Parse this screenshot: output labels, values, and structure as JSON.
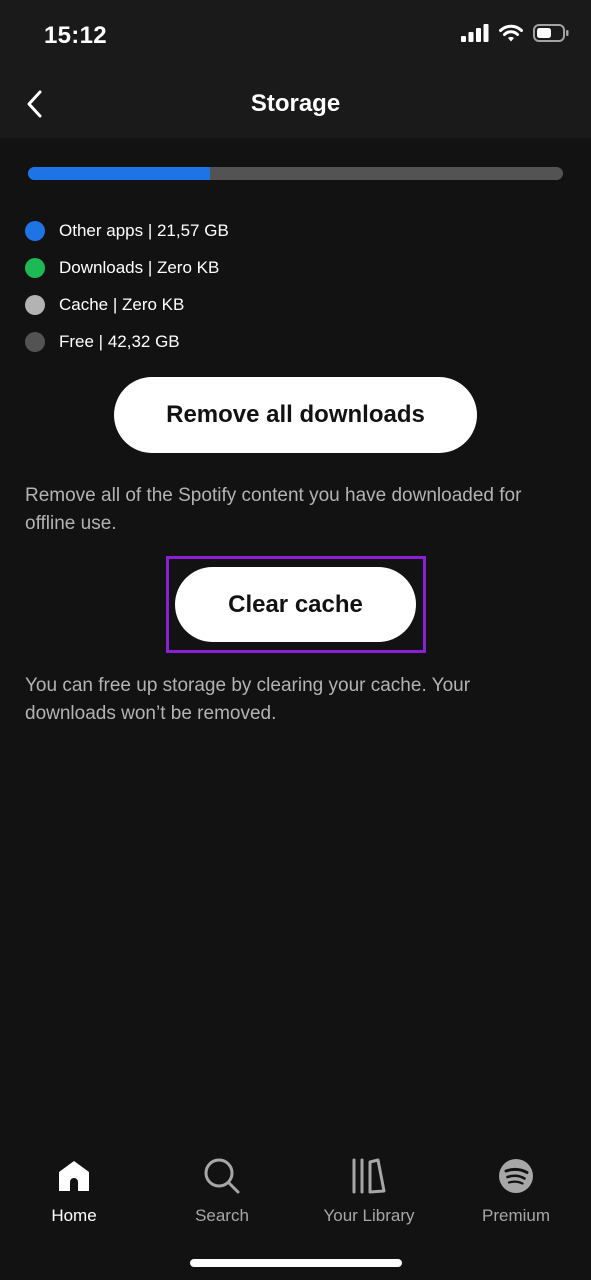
{
  "status_bar": {
    "time": "15:12",
    "icons": [
      "signal-icon",
      "wifi-icon",
      "battery-icon"
    ]
  },
  "header": {
    "title": "Storage",
    "back_icon": "chevron-left-icon"
  },
  "storage": {
    "used_fraction": 0.34,
    "legend": [
      {
        "label": "Other apps | 21,57 GB",
        "color": "#1e74e4"
      },
      {
        "label": "Downloads | Zero KB",
        "color": "#1db954"
      },
      {
        "label": "Cache | Zero KB",
        "color": "#b3b3b3"
      },
      {
        "label": "Free | 42,32 GB",
        "color": "#535353"
      }
    ]
  },
  "actions": {
    "remove_label": "Remove all downloads",
    "remove_description": "Remove all of the Spotify content you have downloaded for offline use.",
    "clear_label": "Clear cache",
    "clear_description": "You can free up storage by clearing your cache. Your downloads won’t be removed.",
    "highlight_color": "#8a1fd6"
  },
  "tabbar": {
    "tabs": [
      {
        "label": "Home",
        "icon": "home-icon",
        "active": true
      },
      {
        "label": "Search",
        "icon": "search-icon",
        "active": false
      },
      {
        "label": "Your Library",
        "icon": "library-icon",
        "active": false
      },
      {
        "label": "Premium",
        "icon": "spotify-logo-icon",
        "active": false
      }
    ]
  }
}
